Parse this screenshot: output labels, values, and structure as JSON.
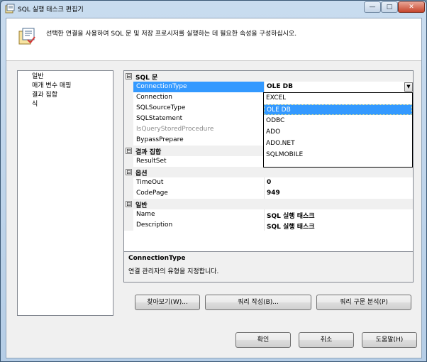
{
  "window": {
    "title": "SQL 실행 태스크 편집기",
    "minimize": "—",
    "maximize": "□",
    "close": "✕"
  },
  "header": {
    "description": "선택한 연결을 사용하여 SQL 문 및 저장 프로시저를 실행하는 데 필요한 속성을 구성하십시오."
  },
  "nav": {
    "items": [
      "일반",
      "매개 변수 매핑",
      "결과 집합",
      "식"
    ]
  },
  "grid": {
    "collapse_glyph": "⊟",
    "categories": {
      "sql": "SQL 문",
      "result": "결과 집합",
      "options": "옵션",
      "general": "일반"
    },
    "props": {
      "connection_type": {
        "name": "ConnectionType",
        "value": "OLE DB"
      },
      "connection": {
        "name": "Connection",
        "value": ""
      },
      "sql_source_type": {
        "name": "SQLSourceType",
        "value": ""
      },
      "sql_statement": {
        "name": "SQLStatement",
        "value": ""
      },
      "is_query_stored_procedure": {
        "name": "IsQueryStoredProcedure",
        "value": ""
      },
      "bypass_prepare": {
        "name": "BypassPrepare",
        "value": ""
      },
      "result_set": {
        "name": "ResultSet",
        "value": ""
      },
      "timeout": {
        "name": "TimeOut",
        "value": "0"
      },
      "code_page": {
        "name": "CodePage",
        "value": "949"
      },
      "name": {
        "name": "Name",
        "value": "SQL 실행 태스크"
      },
      "description": {
        "name": "Description",
        "value": "SQL 실행 태스크"
      }
    },
    "dropdown_arrow": "▼",
    "dropdown_options": [
      "EXCEL",
      "OLE DB",
      "ODBC",
      "ADO",
      "ADO.NET",
      "SQLMOBILE"
    ],
    "dropdown_selected": "OLE DB"
  },
  "description_panel": {
    "title": "ConnectionType",
    "text": "연결 관리자의 유형을 지정합니다."
  },
  "buttons": {
    "browse": "찾아보기(W)...",
    "build_query": "쿼리 작성(B)...",
    "parse_query": "쿼리 구문 분석(P)",
    "ok": "확인",
    "cancel": "취소",
    "help": "도움말(H)"
  }
}
